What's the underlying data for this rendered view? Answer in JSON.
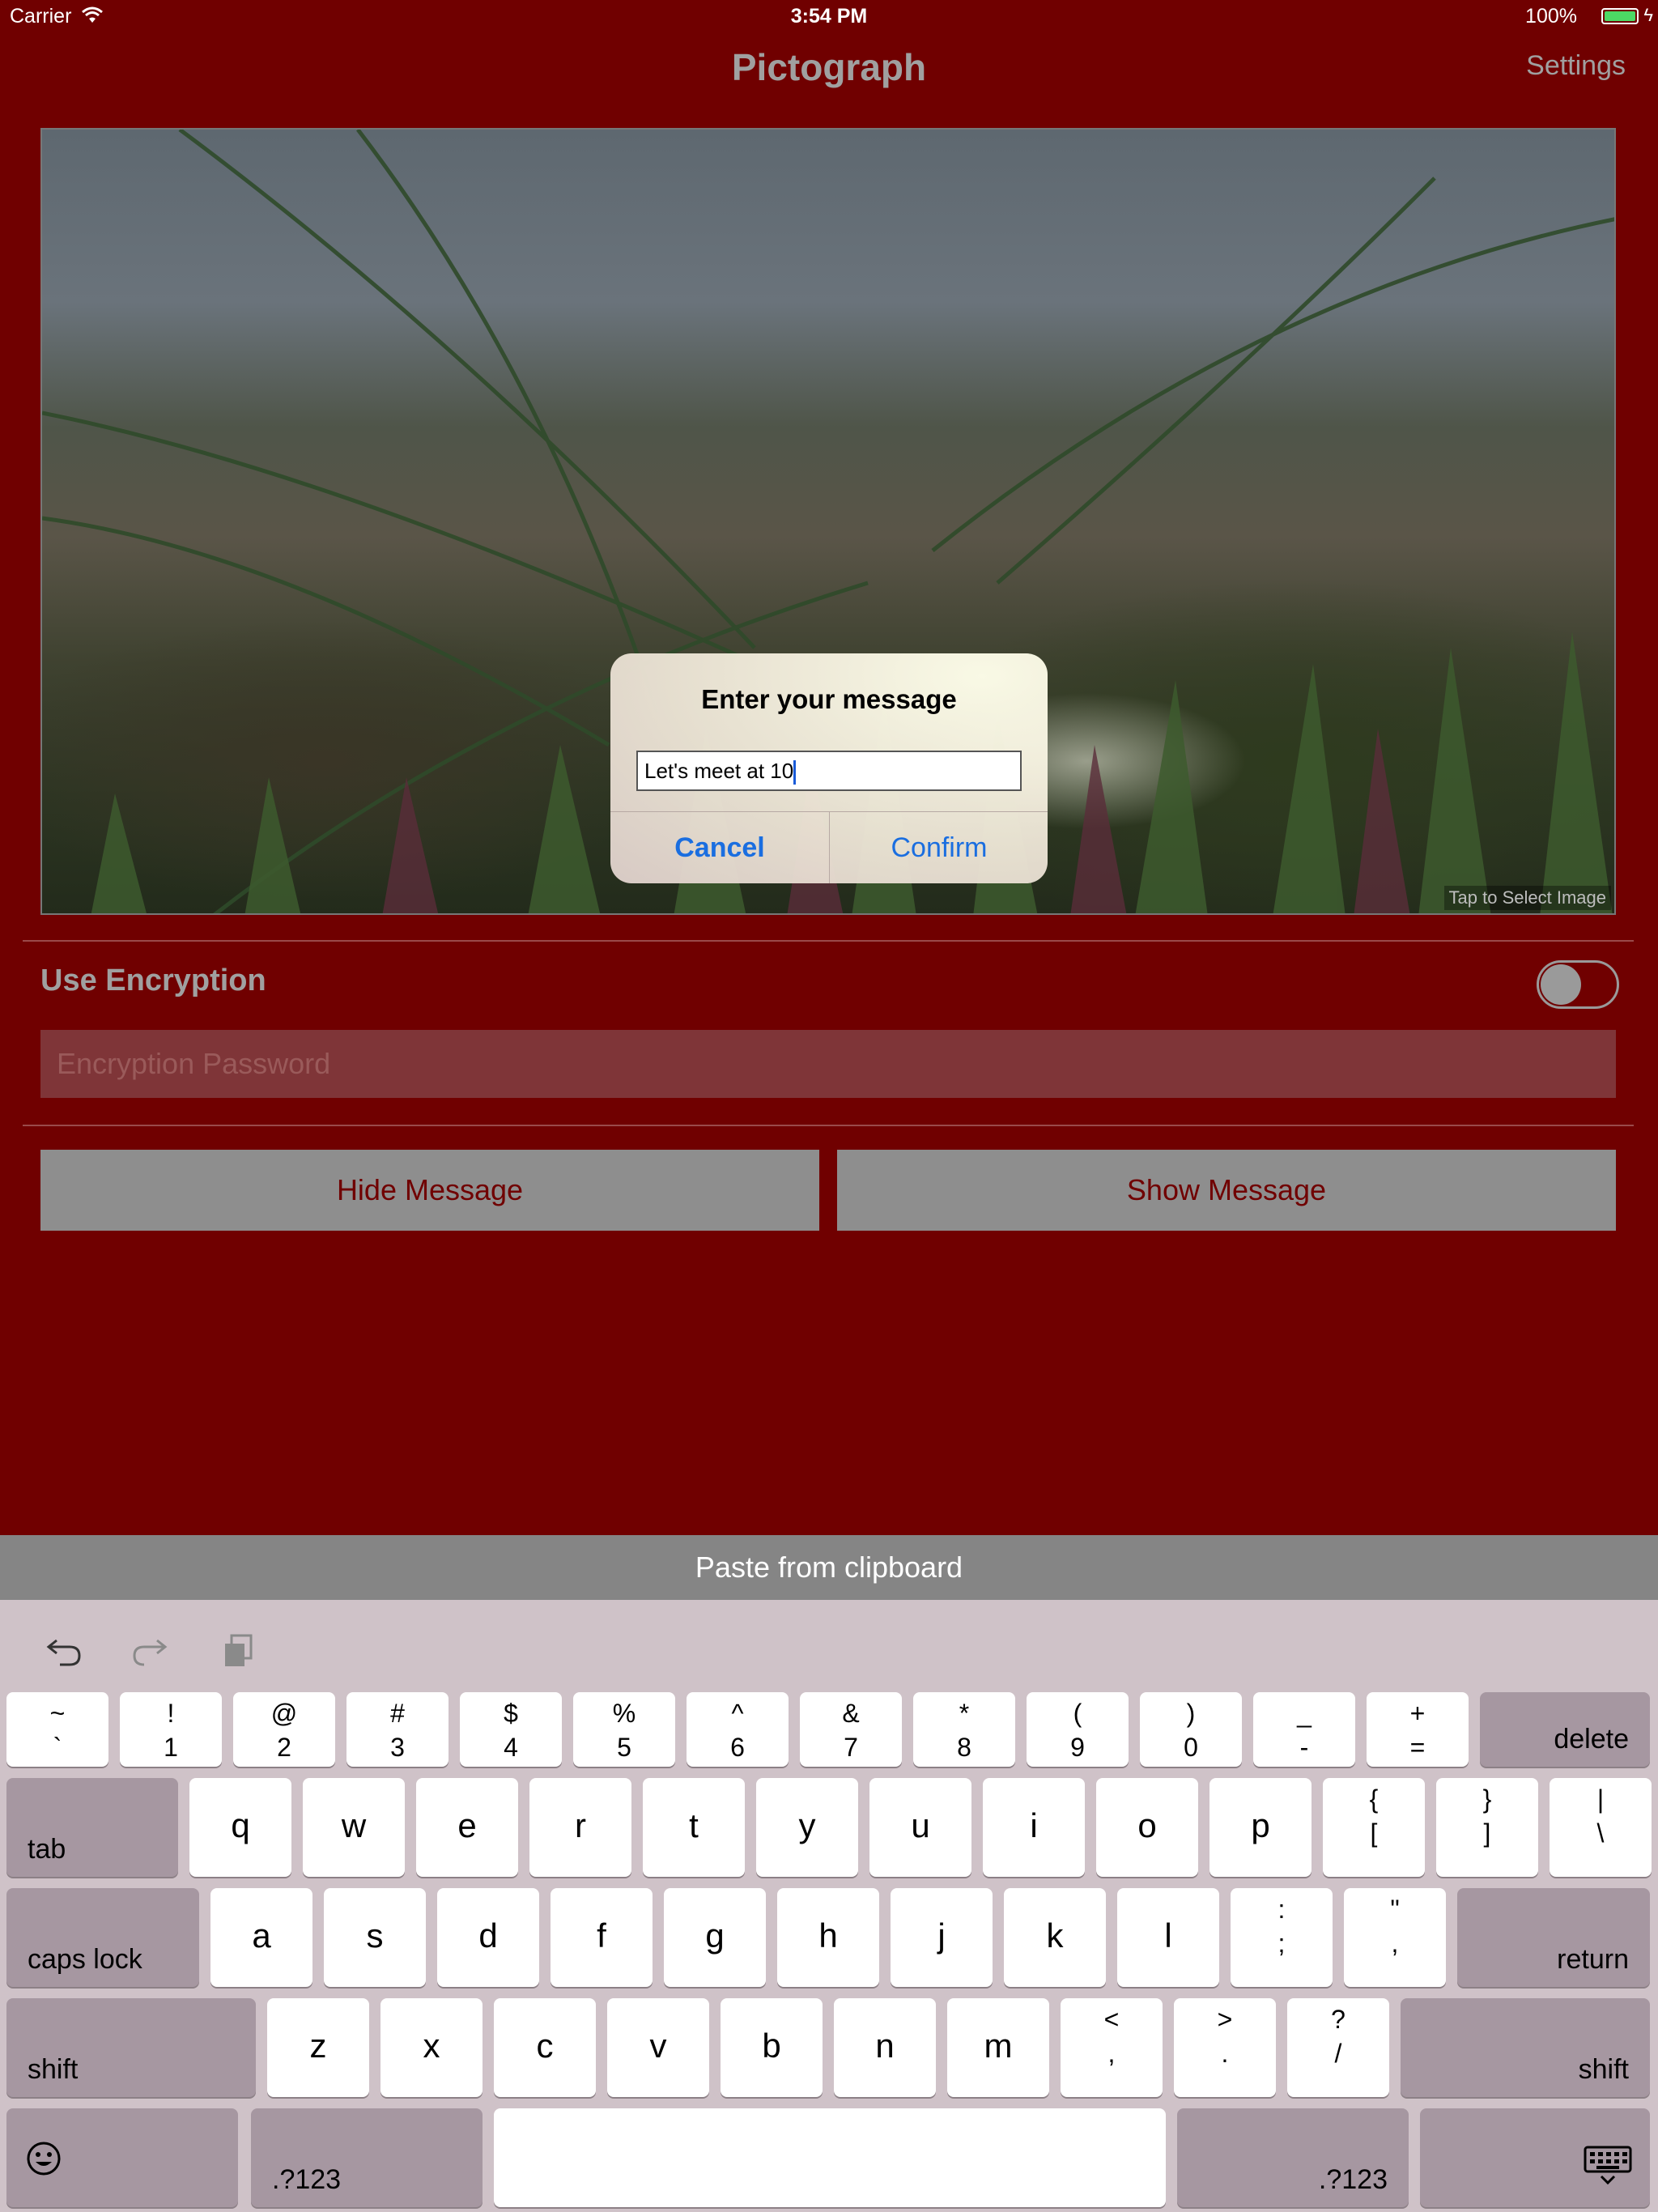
{
  "status_bar": {
    "carrier": "Carrier",
    "time": "3:54 PM",
    "battery": "100%"
  },
  "nav": {
    "title": "Pictograph",
    "settings": "Settings"
  },
  "photo": {
    "tap_label": "Tap to Select Image"
  },
  "encryption": {
    "label": "Use Encryption",
    "enabled": false,
    "password_placeholder": "Encryption Password"
  },
  "buttons": {
    "hide": "Hide Message",
    "show": "Show Message"
  },
  "alert": {
    "title": "Enter your message",
    "value": "Let's meet at 10",
    "cancel": "Cancel",
    "confirm": "Confirm"
  },
  "keyboard": {
    "paste_bar": "Paste from clipboard",
    "row1": [
      {
        "top": "~",
        "bot": "`"
      },
      {
        "top": "!",
        "bot": "1"
      },
      {
        "top": "@",
        "bot": "2"
      },
      {
        "top": "#",
        "bot": "3"
      },
      {
        "top": "$",
        "bot": "4"
      },
      {
        "top": "%",
        "bot": "5"
      },
      {
        "top": "^",
        "bot": "6"
      },
      {
        "top": "&",
        "bot": "7"
      },
      {
        "top": "*",
        "bot": "8"
      },
      {
        "top": "(",
        "bot": "9"
      },
      {
        "top": ")",
        "bot": "0"
      },
      {
        "top": "_",
        "bot": "-"
      },
      {
        "top": "+",
        "bot": "="
      }
    ],
    "delete": "delete",
    "tab": "tab",
    "row2": [
      "q",
      "w",
      "e",
      "r",
      "t",
      "y",
      "u",
      "i",
      "o",
      "p"
    ],
    "row2_sym": [
      {
        "top": "{",
        "bot": "["
      },
      {
        "top": "}",
        "bot": "]"
      },
      {
        "top": "|",
        "bot": "\\"
      }
    ],
    "caps_lock": "caps lock",
    "row3": [
      "a",
      "s",
      "d",
      "f",
      "g",
      "h",
      "j",
      "k",
      "l"
    ],
    "row3_sym": [
      {
        "top": ":",
        "bot": ";"
      },
      {
        "top": "\"",
        "bot": ","
      }
    ],
    "return": "return",
    "shift": "shift",
    "row4": [
      "z",
      "x",
      "c",
      "v",
      "b",
      "n",
      "m"
    ],
    "row4_sym": [
      {
        "top": "<",
        "bot": ","
      },
      {
        "top": ">",
        "bot": "."
      },
      {
        "top": "?",
        "bot": "/"
      }
    ],
    "numbers": ".?123",
    "icons": {
      "emoji": "emoji-icon",
      "dismiss": "keyboard-dismiss-icon",
      "undo": "undo-icon",
      "redo": "redo-icon",
      "paste": "paste-icon"
    }
  }
}
